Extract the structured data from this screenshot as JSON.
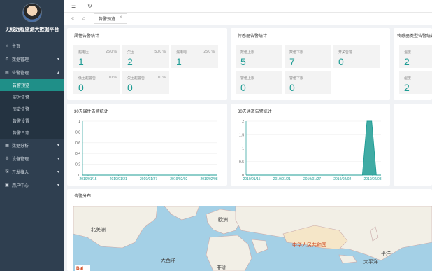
{
  "sidebar": {
    "app_title": "无线远程监测大数据平台",
    "items": [
      {
        "label": "主页",
        "icon": "home-icon",
        "glyph": "⌂"
      },
      {
        "label": "数据管理",
        "icon": "data-icon",
        "glyph": "⚙",
        "chev": "▾"
      },
      {
        "label": "告警管理",
        "icon": "alarm-icon",
        "glyph": "▤",
        "chev": "▴"
      }
    ],
    "sub_items": [
      {
        "label": "告警预览",
        "active": true
      },
      {
        "label": "实时告警"
      },
      {
        "label": "历史告警"
      },
      {
        "label": "告警设置"
      },
      {
        "label": "告警日志"
      }
    ],
    "items2": [
      {
        "label": "数据分析",
        "icon": "analysis-icon",
        "glyph": "▦",
        "chev": "▾"
      },
      {
        "label": "设备管理",
        "icon": "device-icon",
        "glyph": "✢",
        "chev": "▾"
      },
      {
        "label": "开发接入",
        "icon": "dev-icon",
        "glyph": "⎘",
        "chev": "▾"
      },
      {
        "label": "用户中心",
        "icon": "user-icon",
        "glyph": "▣",
        "chev": "▾"
      }
    ]
  },
  "topbar": {
    "menu_icon": "☰",
    "refresh_icon": "↻"
  },
  "tabbar": {
    "back_icon": "«",
    "home_icon": "⌂",
    "tab_label": "告警预览",
    "tab_close": "×"
  },
  "cards": {
    "attr": {
      "title": "属性告警统计",
      "stats": [
        {
          "label": "超电压",
          "pct": "25.0 %",
          "value": "1"
        },
        {
          "label": "欠压",
          "pct": "50.0 %",
          "value": "2"
        },
        {
          "label": "漏电电",
          "pct": "25.0 %",
          "value": "1"
        },
        {
          "label": "低压超警告",
          "pct": "0.0 %",
          "value": "0"
        },
        {
          "label": "欠压超警告",
          "pct": "0.0 %",
          "value": "0"
        }
      ]
    },
    "sensor": {
      "title": "传感器告警统计",
      "stats": [
        {
          "label": "数值上限",
          "value": "5"
        },
        {
          "label": "数值下限",
          "value": "7"
        },
        {
          "label": "开关告警",
          "value": "0"
        },
        {
          "label": "警值上限",
          "value": "0"
        },
        {
          "label": "警值下限",
          "value": "0"
        }
      ]
    },
    "sensor_type": {
      "title": "传感器类型告警统计",
      "stats": [
        {
          "label": "温度",
          "value": "2"
        },
        {
          "label": "湿度",
          "value": "2"
        }
      ]
    },
    "map": {
      "title": "告警分布",
      "labels": {
        "na": "北美洲",
        "eu": "欧洲",
        "ao": "大西洋",
        "cn": "中华人民共和国",
        "af": "非洲",
        "pac1": "平洋",
        "pac2": "太平洋",
        "baidu": "Bai"
      }
    }
  },
  "chart_data": [
    {
      "type": "line",
      "title": "30天属性告警统计",
      "x_ticks": [
        "2019/01/15",
        "2019/01/21",
        "2019/01/27",
        "2019/02/02",
        "2019/02/08"
      ],
      "y_ticks": [
        "0",
        "0.2",
        "0.4",
        "0.6",
        "0.8",
        "1"
      ],
      "ylim": [
        0,
        1
      ],
      "values": [
        0,
        0,
        0,
        0,
        0,
        0,
        0,
        0,
        0,
        0,
        0,
        0,
        0,
        0,
        0,
        0,
        0,
        0,
        0,
        0,
        0,
        0,
        0,
        0,
        0,
        0,
        0,
        0,
        0,
        0
      ],
      "color": "#1e9c94"
    },
    {
      "type": "area",
      "title": "30天通道告警统计",
      "x_ticks": [
        "2019/01/15",
        "2019/01/21",
        "2019/01/27",
        "2019/02/02",
        "2019/02/08"
      ],
      "y_ticks": [
        "0",
        "0.5",
        "1",
        "1.5",
        "2"
      ],
      "ylim": [
        0,
        2
      ],
      "values": [
        0,
        0,
        0,
        0,
        0,
        0,
        0,
        0,
        0,
        0,
        0,
        0,
        0,
        0,
        0,
        0,
        0,
        0,
        0,
        0,
        0,
        0,
        0,
        0,
        0,
        0,
        2,
        2,
        0,
        0
      ],
      "color": "#1e9c94"
    }
  ]
}
